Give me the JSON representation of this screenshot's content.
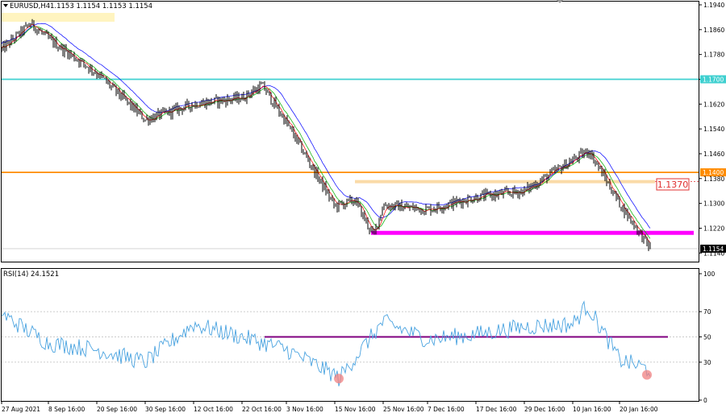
{
  "header": {
    "symbol": "EURUSD,H4",
    "ohlc": "1.1153 1.1154 1.1153 1.1154"
  },
  "colors": {
    "candles": "#000000",
    "ma_fast": "#ff0000",
    "ma_mid": "#00b000",
    "ma_slow": "#0000ff",
    "cyan_level": "#40d0d0",
    "orange_level": "#ff8c00",
    "support": "#ff00ff",
    "rsi_line": "#4aa3e0",
    "rsi_50_line": "#800080",
    "highlight": "#f5b041",
    "oversold_marker": "#f08080"
  },
  "chart_data": [
    {
      "type": "line",
      "title": "EURUSD,H4",
      "ylim": [
        1.112,
        1.194
      ],
      "y_ticks": [
        "1.1940",
        "1.1860",
        "1.1780",
        "1.1700",
        "1.1620",
        "1.1540",
        "1.1460",
        "1.1380",
        "1.1300",
        "1.1220",
        "1.1140"
      ],
      "x_ticks": [
        "27 Aug 2021",
        "8 Sep 16:00",
        "20 Sep 16:00",
        "30 Sep 16:00",
        "12 Oct 16:00",
        "22 Oct 16:00",
        "3 Nov 16:00",
        "15 Nov 16:00",
        "25 Nov 16:00",
        "7 Dec 16:00",
        "17 Dec 16:00",
        "29 Dec 16:00",
        "10 Jan 16:00",
        "20 Jan 16:00"
      ],
      "series": [
        {
          "x": [
            "27 Aug 2021",
            "8 Sep 16:00",
            "20 Sep 16:00",
            "30 Sep 16:00",
            "12 Oct 16:00",
            "22 Oct 16:00",
            "3 Nov 16:00",
            "15 Nov 16:00",
            "25 Nov 16:00",
            "7 Dec 16:00",
            "17 Dec 16:00",
            "29 Dec 16:00",
            "10 Jan 16:00",
            "20 Jan 16:00"
          ],
          "values": [
            1.1795,
            1.183,
            1.172,
            1.157,
            1.162,
            1.164,
            1.156,
            1.129,
            1.1295,
            1.128,
            1.132,
            1.134,
            1.144,
            1.13
          ]
        }
      ],
      "extra_points": {
        "peak": 1.188,
        "low_start": 1.1195,
        "last": 1.1154
      },
      "levels": [
        {
          "label": "1.1700",
          "value": 1.17,
          "color": "#40d0d0"
        },
        {
          "label": "1.1400",
          "value": 1.14,
          "color": "#ff8c00"
        },
        {
          "label": "1.1154",
          "value": 1.1154,
          "color": "#bbbbbb"
        }
      ],
      "support_level": 1.1205,
      "resistance_zone_value": 1.137,
      "annotation": "1.1370"
    },
    {
      "type": "line",
      "title": "RSI(14) 24.1521",
      "ylim": [
        0,
        100
      ],
      "y_ticks": [
        "100",
        "70",
        "50",
        "30",
        "0"
      ],
      "levels": [
        70,
        50,
        30
      ],
      "series": [
        {
          "x": [
            "27 Aug 2021",
            "8 Sep 16:00",
            "20 Sep 16:00",
            "30 Sep 16:00",
            "12 Oct 16:00",
            "22 Oct 16:00",
            "3 Nov 16:00",
            "15 Nov 16:00",
            "25 Nov 16:00",
            "7 Dec 16:00",
            "17 Dec 16:00",
            "29 Dec 16:00",
            "10 Jan 16:00",
            "20 Jan 16:00"
          ],
          "values": [
            68,
            45,
            40,
            30,
            60,
            50,
            40,
            20,
            62,
            48,
            52,
            58,
            60,
            32
          ]
        }
      ],
      "extra_points": {
        "peak": 75,
        "oversold_1": 17,
        "last": 24
      }
    }
  ]
}
